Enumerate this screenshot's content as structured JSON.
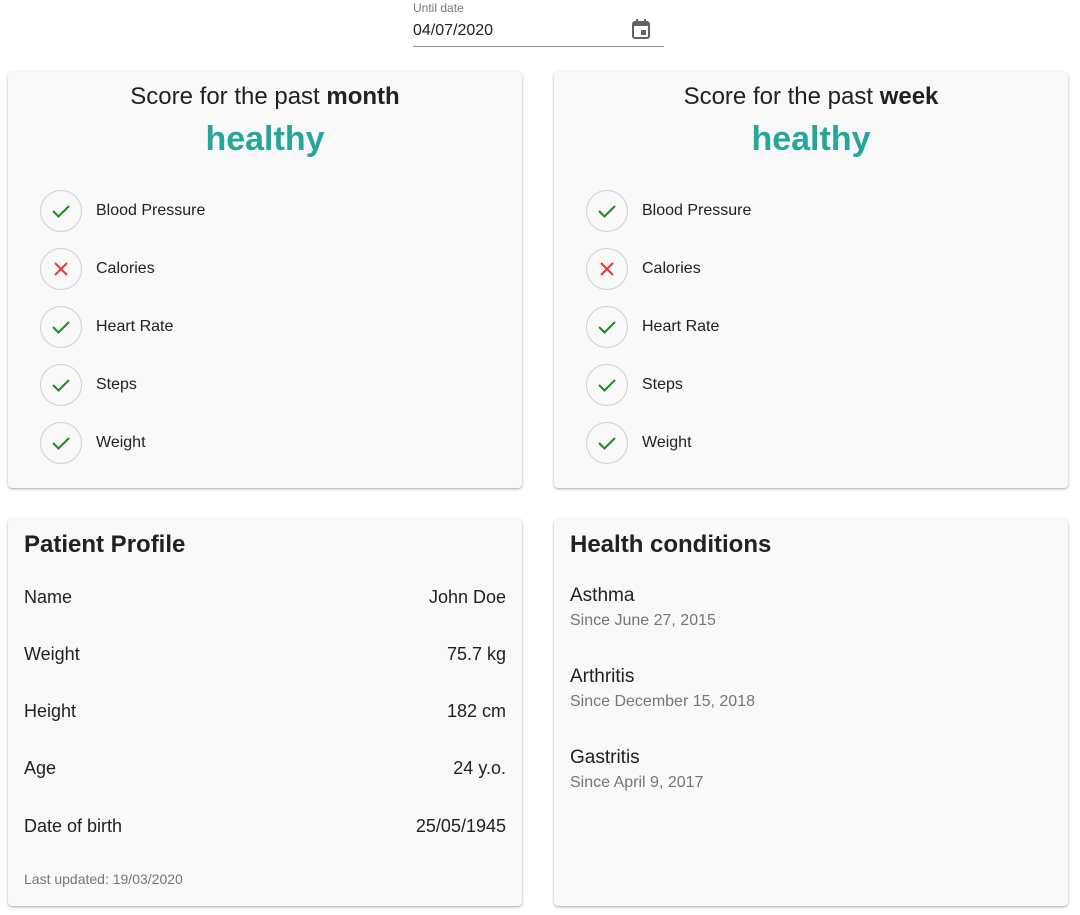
{
  "date_filter": {
    "label": "Until date",
    "value": "04/07/2020",
    "icon": "calendar-icon"
  },
  "score_cards": [
    {
      "title_prefix": "Score for the past",
      "title_period": "month",
      "status": "healthy",
      "status_color": "#26a69a",
      "metrics": [
        {
          "label": "Blood Pressure",
          "ok": true
        },
        {
          "label": "Calories",
          "ok": false
        },
        {
          "label": "Heart Rate",
          "ok": true
        },
        {
          "label": "Steps",
          "ok": true
        },
        {
          "label": "Weight",
          "ok": true
        }
      ]
    },
    {
      "title_prefix": "Score for the past",
      "title_period": "week",
      "status": "healthy",
      "status_color": "#26a69a",
      "metrics": [
        {
          "label": "Blood Pressure",
          "ok": true
        },
        {
          "label": "Calories",
          "ok": false
        },
        {
          "label": "Heart Rate",
          "ok": true
        },
        {
          "label": "Steps",
          "ok": true
        },
        {
          "label": "Weight",
          "ok": true
        }
      ]
    }
  ],
  "icons": {
    "ok": "check-icon",
    "fail": "cross-icon",
    "ok_color": "#1e8a1e",
    "fail_color": "#e53935"
  },
  "patient_profile": {
    "heading": "Patient Profile",
    "rows": [
      {
        "label": "Name",
        "value": "John Doe"
      },
      {
        "label": "Weight",
        "value": "75.7 kg"
      },
      {
        "label": "Height",
        "value": "182 cm"
      },
      {
        "label": "Age",
        "value": "24 y.o."
      },
      {
        "label": "Date of birth",
        "value": "25/05/1945"
      }
    ],
    "last_updated": "Last updated: 19/03/2020"
  },
  "health_conditions": {
    "heading": "Health conditions",
    "items": [
      {
        "name": "Asthma",
        "since": "Since June 27, 2015"
      },
      {
        "name": "Arthritis",
        "since": "Since December 15, 2018"
      },
      {
        "name": "Gastritis",
        "since": "Since April 9, 2017"
      }
    ]
  }
}
